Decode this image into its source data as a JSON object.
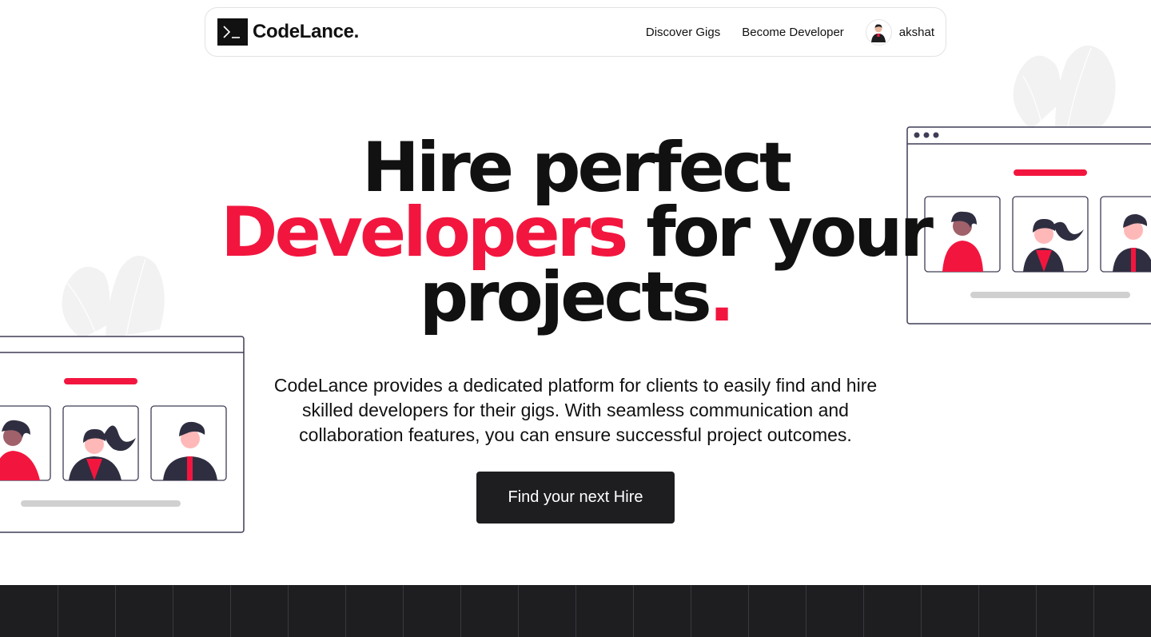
{
  "nav": {
    "logo_text": "CodeLance.",
    "links": [
      "Discover Gigs",
      "Become Developer"
    ],
    "username": "akshat"
  },
  "hero": {
    "title_line1": "Hire perfect",
    "title_accent": "Developers",
    "title_line2_rest": " for your",
    "title_line3": "projects",
    "title_dot": ".",
    "subtitle": "CodeLance provides a dedicated platform for clients to easily find and hire skilled developers for their gigs. With seamless communication and collaboration features, you can ensure successful project outcomes.",
    "cta_label": "Find your next Hire"
  },
  "icons": {
    "logo": "terminal-prompt-icon",
    "avatar": "user-avatar",
    "illustrations": [
      "developer-profiles-window-illustration",
      "leaf-decoration"
    ]
  },
  "colors": {
    "accent": "#f2163f",
    "dark": "#1e1e21",
    "text": "#111111",
    "outline": "#3f3d56",
    "leaf": "#f2f2f2"
  }
}
